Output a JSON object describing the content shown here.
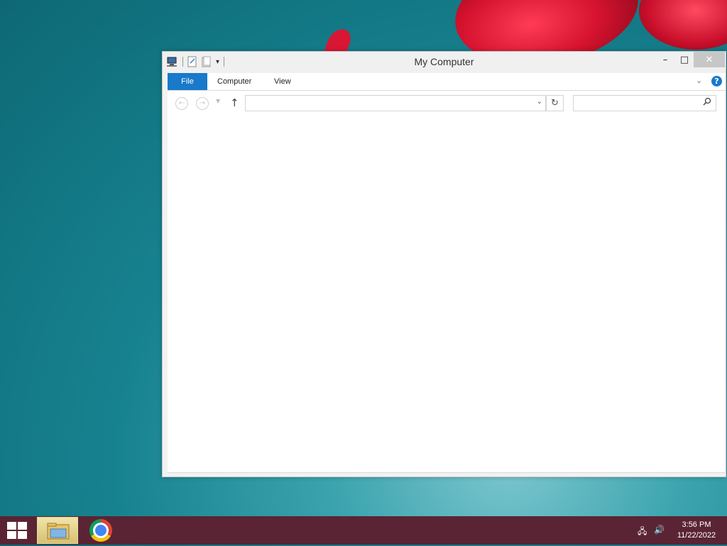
{
  "window": {
    "title": "My Computer",
    "quick_access_icons": [
      "computer-icon",
      "properties-icon",
      "new-folder-icon",
      "customize-dropdown-icon"
    ],
    "controls": {
      "minimize": "–",
      "maximize": "□",
      "close": "✕"
    }
  },
  "ribbon": {
    "tabs": [
      {
        "label": "File",
        "active": true,
        "color": "#1979ca"
      },
      {
        "label": "Computer",
        "active": false
      },
      {
        "label": "View",
        "active": false
      }
    ],
    "help_label": "?"
  },
  "navigation": {
    "address_value": "",
    "search_placeholder": ""
  },
  "taskbar": {
    "color": "#5a2434",
    "items": [
      "start-button",
      "file-explorer",
      "google-chrome"
    ],
    "tray": [
      "network-icon",
      "volume-icon"
    ],
    "clock": {
      "time": "3:56 PM",
      "date": "11/22/2022"
    }
  }
}
